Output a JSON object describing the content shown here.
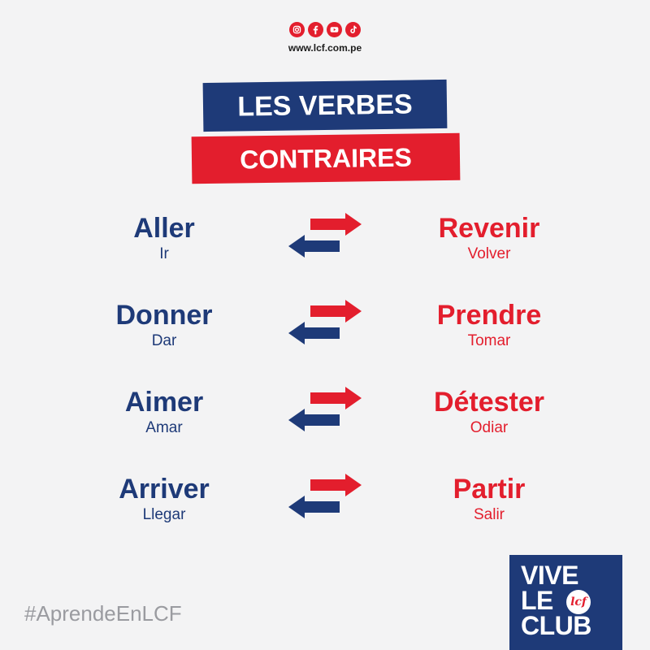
{
  "header": {
    "social_icons": [
      "instagram-icon",
      "facebook-icon",
      "youtube-icon",
      "tiktok-icon"
    ],
    "website": "www.lcf.com.pe"
  },
  "title": {
    "line1": "LES VERBES",
    "line2": "CONTRAIRES"
  },
  "pairs": [
    {
      "left_fr": "Aller",
      "left_es": "Ir",
      "right_fr": "Revenir",
      "right_es": "Volver"
    },
    {
      "left_fr": "Donner",
      "left_es": "Dar",
      "right_fr": "Prendre",
      "right_es": "Tomar"
    },
    {
      "left_fr": "Aimer",
      "left_es": "Amar",
      "right_fr": "Détester",
      "right_es": "Odiar"
    },
    {
      "left_fr": "Arriver",
      "left_es": "Llegar",
      "right_fr": "Partir",
      "right_es": "Salir"
    }
  ],
  "footer": {
    "hashtag": "#AprendeEnLCF",
    "logo_line1": "VIVE",
    "logo_line2": "LE",
    "logo_line3": "CLUB",
    "logo_mark": "lcf"
  },
  "colors": {
    "blue": "#1e3a78",
    "red": "#e31e2d",
    "background": "#f3f3f4"
  }
}
